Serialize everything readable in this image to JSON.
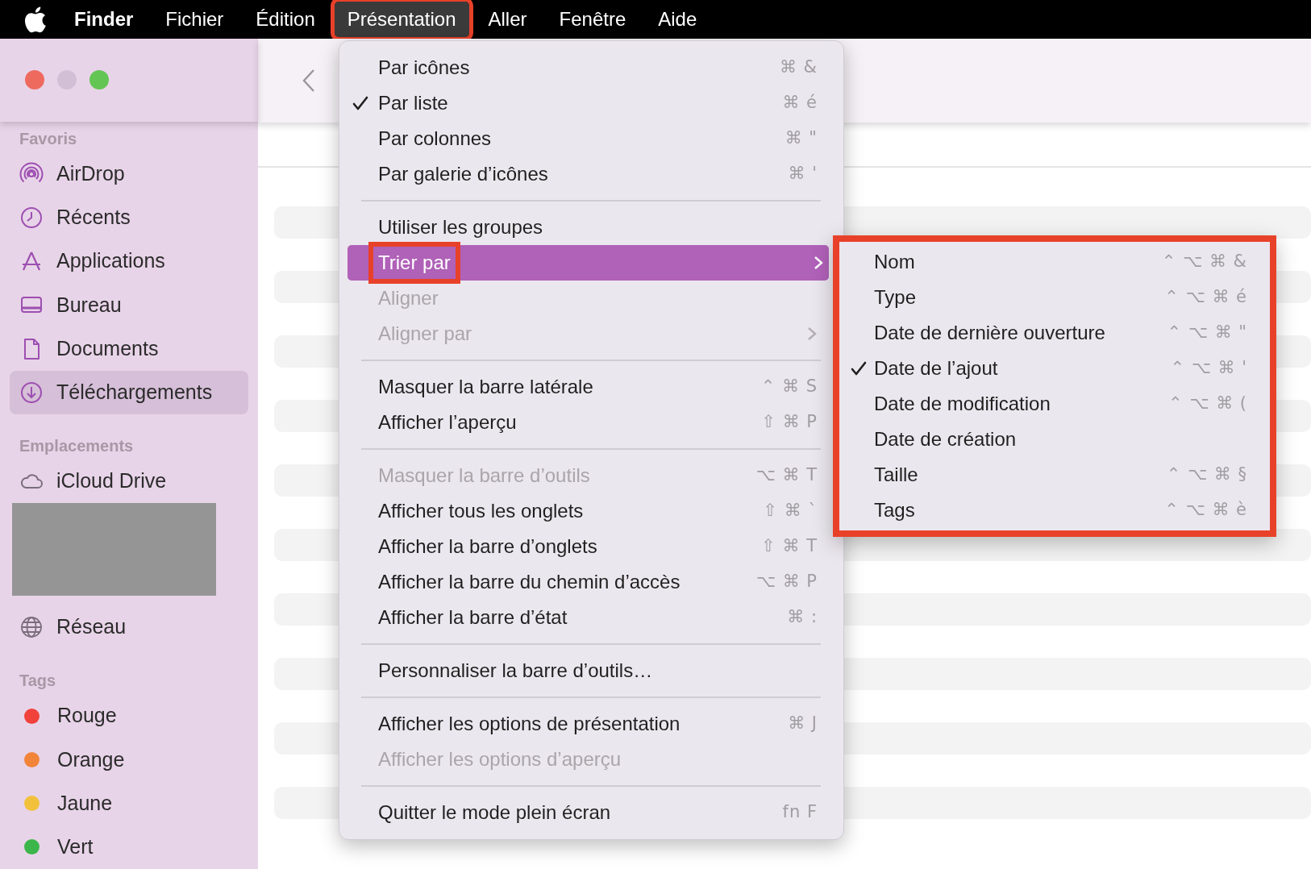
{
  "menubar": {
    "items": [
      {
        "label": "Finder",
        "kind": "app",
        "open": false,
        "annotated": false
      },
      {
        "label": "Fichier",
        "kind": "menu",
        "open": false,
        "annotated": false
      },
      {
        "label": "Édition",
        "kind": "menu",
        "open": false,
        "annotated": false
      },
      {
        "label": "Présentation",
        "kind": "menu",
        "open": true,
        "annotated": true
      },
      {
        "label": "Aller",
        "kind": "menu",
        "open": false,
        "annotated": false
      },
      {
        "label": "Fenêtre",
        "kind": "menu",
        "open": false,
        "annotated": false
      },
      {
        "label": "Aide",
        "kind": "menu",
        "open": false,
        "annotated": false
      }
    ]
  },
  "sidebar": {
    "sections": [
      {
        "title": "Favoris",
        "items": [
          {
            "kind": "place",
            "label": "AirDrop",
            "selected": false
          },
          {
            "kind": "place",
            "label": "Récents",
            "selected": false
          },
          {
            "kind": "place",
            "label": "Applications",
            "selected": false
          },
          {
            "kind": "place",
            "label": "Bureau",
            "selected": false
          },
          {
            "kind": "place",
            "label": "Documents",
            "selected": false
          },
          {
            "kind": "place",
            "label": "Téléchargements",
            "selected": true
          }
        ]
      },
      {
        "title": "Emplacements",
        "items": [
          {
            "kind": "place",
            "label": "iCloud Drive",
            "selected": false
          },
          {
            "kind": "redacted"
          },
          {
            "kind": "place",
            "label": "Réseau",
            "selected": false
          }
        ]
      },
      {
        "title": "Tags",
        "items": [
          {
            "kind": "tag",
            "label": "Rouge",
            "color": "#f0413b",
            "selected": false
          },
          {
            "kind": "tag",
            "label": "Orange",
            "color": "#f2843a",
            "selected": false
          },
          {
            "kind": "tag",
            "label": "Jaune",
            "color": "#f2c13c",
            "selected": false
          },
          {
            "kind": "tag",
            "label": "Vert",
            "color": "#3cb64a",
            "selected": false
          }
        ]
      }
    ]
  },
  "menu": {
    "items": [
      {
        "kind": "item",
        "label": "Par icônes",
        "shortcut": "⌘ &",
        "checked": false,
        "disabled": false,
        "selected": false,
        "submenu": false,
        "annotated": false
      },
      {
        "kind": "item",
        "label": "Par liste",
        "shortcut": "⌘ é",
        "checked": true,
        "disabled": false,
        "selected": false,
        "submenu": false,
        "annotated": false
      },
      {
        "kind": "item",
        "label": "Par colonnes",
        "shortcut": "⌘ \"",
        "checked": false,
        "disabled": false,
        "selected": false,
        "submenu": false,
        "annotated": false
      },
      {
        "kind": "item",
        "label": "Par galerie d’icônes",
        "shortcut": "⌘ '",
        "checked": false,
        "disabled": false,
        "selected": false,
        "submenu": false,
        "annotated": false
      },
      {
        "kind": "separator"
      },
      {
        "kind": "item",
        "label": "Utiliser les groupes",
        "checked": false,
        "disabled": false,
        "selected": false,
        "submenu": false,
        "annotated": false
      },
      {
        "kind": "item",
        "label": "Trier par",
        "checked": false,
        "disabled": false,
        "selected": true,
        "submenu": true,
        "annotated": true
      },
      {
        "kind": "item",
        "label": "Aligner",
        "checked": false,
        "disabled": true,
        "selected": false,
        "submenu": false,
        "annotated": false
      },
      {
        "kind": "item",
        "label": "Aligner par",
        "checked": false,
        "disabled": true,
        "selected": false,
        "submenu": true,
        "annotated": false
      },
      {
        "kind": "separator"
      },
      {
        "kind": "item",
        "label": "Masquer la barre latérale",
        "shortcut": "⌃ ⌘ S",
        "checked": false,
        "disabled": false,
        "selected": false,
        "submenu": false,
        "annotated": false
      },
      {
        "kind": "item",
        "label": "Afficher l’aperçu",
        "shortcut": "⇧ ⌘ P",
        "checked": false,
        "disabled": false,
        "selected": false,
        "submenu": false,
        "annotated": false
      },
      {
        "kind": "separator"
      },
      {
        "kind": "item",
        "label": "Masquer la barre d’outils",
        "shortcut": "⌥ ⌘ T",
        "checked": false,
        "disabled": true,
        "selected": false,
        "submenu": false,
        "annotated": false
      },
      {
        "kind": "item",
        "label": "Afficher tous les onglets",
        "shortcut": "⇧ ⌘ `",
        "checked": false,
        "disabled": false,
        "selected": false,
        "submenu": false,
        "annotated": false
      },
      {
        "kind": "item",
        "label": "Afficher la barre d’onglets",
        "shortcut": "⇧ ⌘ T",
        "checked": false,
        "disabled": false,
        "selected": false,
        "submenu": false,
        "annotated": false
      },
      {
        "kind": "item",
        "label": "Afficher la barre du chemin d’accès",
        "shortcut": "⌥ ⌘ P",
        "checked": false,
        "disabled": false,
        "selected": false,
        "submenu": false,
        "annotated": false
      },
      {
        "kind": "item",
        "label": "Afficher la barre d’état",
        "shortcut": "⌘ :",
        "checked": false,
        "disabled": false,
        "selected": false,
        "submenu": false,
        "annotated": false
      },
      {
        "kind": "separator"
      },
      {
        "kind": "item",
        "label": "Personnaliser la barre d’outils…",
        "checked": false,
        "disabled": false,
        "selected": false,
        "submenu": false,
        "annotated": false
      },
      {
        "kind": "separator"
      },
      {
        "kind": "item",
        "label": "Afficher les options de présentation",
        "shortcut": "⌘ J",
        "checked": false,
        "disabled": false,
        "selected": false,
        "submenu": false,
        "annotated": false
      },
      {
        "kind": "item",
        "label": "Afficher les options d’aperçu",
        "checked": false,
        "disabled": true,
        "selected": false,
        "submenu": false,
        "annotated": false
      },
      {
        "kind": "separator"
      },
      {
        "kind": "item",
        "label": "Quitter le mode plein écran",
        "shortcut": "fn F",
        "checked": false,
        "disabled": false,
        "selected": false,
        "submenu": false,
        "annotated": false
      }
    ]
  },
  "submenu": {
    "annotated": true,
    "items": [
      {
        "label": "Nom",
        "shortcut": "⌃ ⌥ ⌘ &",
        "checked": false
      },
      {
        "label": "Type",
        "shortcut": "⌃ ⌥ ⌘ é",
        "checked": false
      },
      {
        "label": "Date de dernière ouverture",
        "shortcut": "⌃ ⌥ ⌘ \"",
        "checked": false
      },
      {
        "label": "Date de l’ajout",
        "shortcut": "⌃ ⌥ ⌘ '",
        "checked": true
      },
      {
        "label": "Date de modification",
        "shortcut": "⌃ ⌥ ⌘ (",
        "checked": false
      },
      {
        "label": "Date de création",
        "checked": false
      },
      {
        "label": "Taille",
        "shortcut": "⌃ ⌥ ⌘ §",
        "checked": false
      },
      {
        "label": "Tags",
        "shortcut": "⌃ ⌥ ⌘ è",
        "checked": false
      }
    ]
  }
}
